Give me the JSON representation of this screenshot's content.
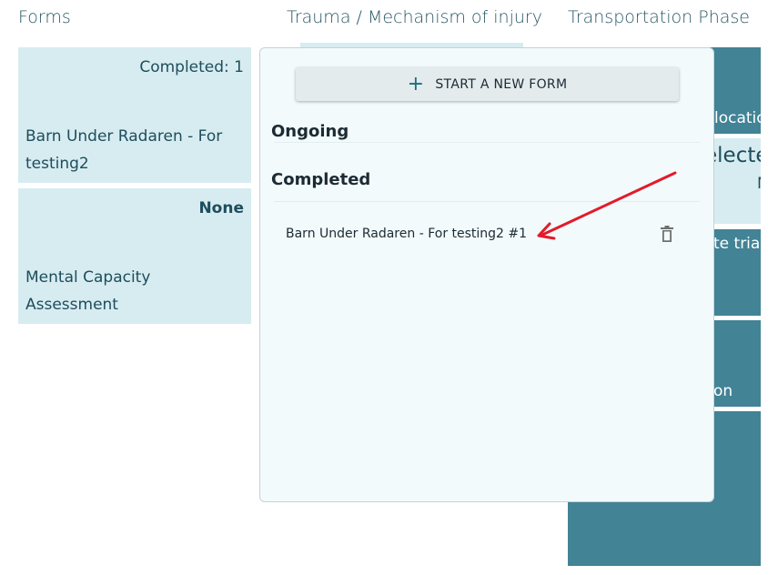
{
  "headers": {
    "forms": "Forms",
    "trauma": "Trauma / Mechanism of injury",
    "transport": "Transportation Phase"
  },
  "cards": [
    {
      "status": "Completed: 1",
      "name": "Barn Under Radaren - For testing2"
    },
    {
      "status": "None",
      "name": "Mental Capacity Assessment"
    }
  ],
  "right_blocks": [
    "locatio",
    "electe",
    "N",
    "te tria",
    "on"
  ],
  "popover": {
    "start_button": "START A NEW FORM",
    "ongoing_label": "Ongoing",
    "completed_label": "Completed",
    "completed_items": [
      {
        "label": "Barn Under Radaren - For testing2 #1"
      }
    ]
  },
  "annotation_color": "#e21b2a"
}
